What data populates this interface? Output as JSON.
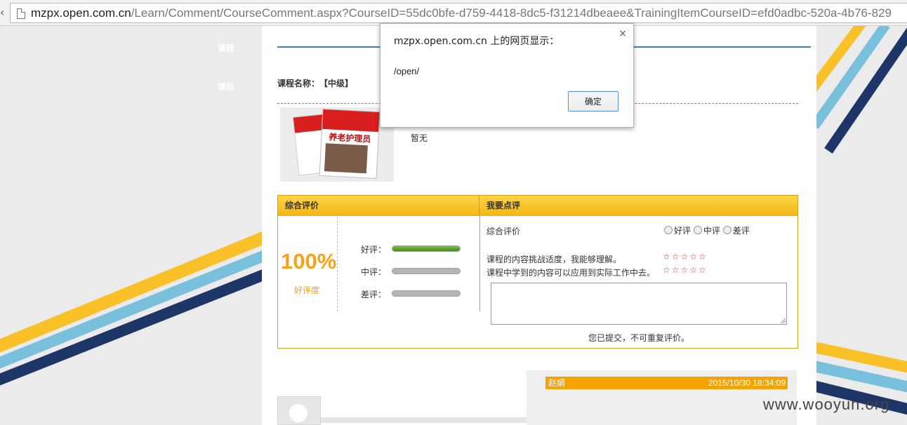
{
  "address_bar": {
    "host": "mzpx.open.com.cn",
    "path": "/Learn/Comment/CourseComment.aspx?CourseID=55dc0bfe-d759-4418-8dc5-f31214dbeaee&TrainingItemCourseID=efd0adbc-520a-4b76-829"
  },
  "side_labels": [
    "课程",
    "课标"
  ],
  "course": {
    "name_label": "课程名称：",
    "level": "【中级】",
    "cover_title": "养老护理员",
    "description": "暂无"
  },
  "overall": {
    "header": "综合评价",
    "percent_text": "100%",
    "percent_label": "好评度",
    "bars": [
      {
        "label": "好评：",
        "fraction": 1.0
      },
      {
        "label": "中评：",
        "fraction": 0.0
      },
      {
        "label": "差评：",
        "fraction": 0.0
      }
    ]
  },
  "review_form": {
    "header": "我要点评",
    "overall_label": "综合评价",
    "options": [
      "好评",
      "中评",
      "差评"
    ],
    "questions": [
      {
        "text": "课程的内容挑战适度，我能够理解。",
        "stars": 5
      },
      {
        "text": "课程中学到的内容可以应用到实际工作中去。",
        "stars": 5
      }
    ],
    "textarea_value": "",
    "submitted_note": "您已提交，不可重复评价。"
  },
  "comment": {
    "user": "赵娟",
    "time": "2015/10/30 18:34:09"
  },
  "dialog": {
    "title": "mzpx.open.com.cn 上的网页显示：",
    "message": "/open/",
    "ok_label": "确定",
    "close_glyph": "×"
  },
  "watermark": "www.wooyun.org",
  "colors": {
    "accent_blue": "#3a7dc9",
    "rating_orange": "#f7a21b",
    "header_yellow": "#f3b612",
    "bar_green": "#5aa824",
    "stripe_yellow": "#f9c027",
    "stripe_lightblue": "#79c0dc",
    "stripe_navy": "#1d3567"
  }
}
